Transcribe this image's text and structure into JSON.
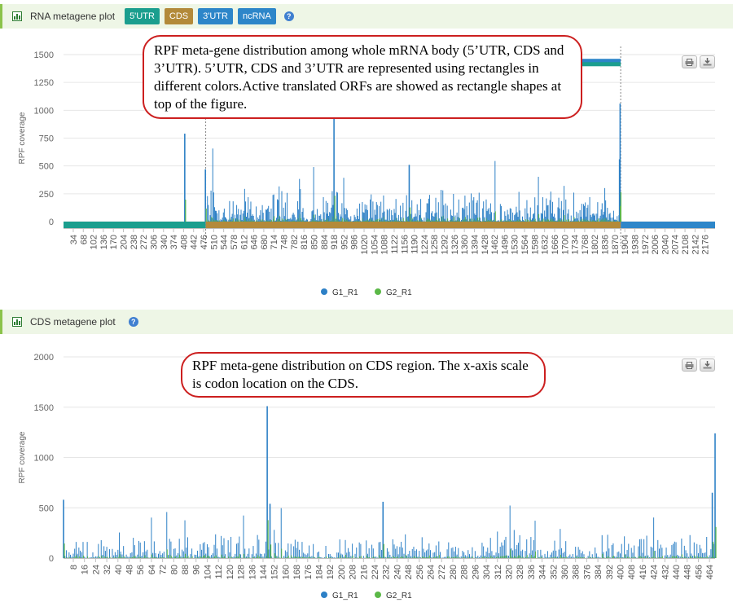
{
  "panels": [
    {
      "title": "RNA metagene plot",
      "badges": [
        {
          "label": "5'UTR",
          "color": "#1b9e8e"
        },
        {
          "label": "CDS",
          "color": "#b38a3a"
        },
        {
          "label": "3'UTR",
          "color": "#2d86c9"
        },
        {
          "label": "ncRNA",
          "color": "#2d86c9"
        }
      ]
    },
    {
      "title": "CDS metagene plot",
      "badges": []
    }
  ],
  "annotations": {
    "rna": "RPF meta-gene distribution among whole mRNA body (5’UTR, CDS and 3’UTR). 5’UTR, CDS and 3’UTR are represented using rectangles in different colors.Active translated ORFs are showed as rectangle shapes at top of the figure.",
    "cds": "RPF meta-gene distribution on CDS region. The x-axis scale is codon location on the CDS."
  },
  "colors": {
    "G1_R1": "#2d80c6",
    "G2_R1": "#5bb847",
    "utr5": "#1b9e8e",
    "cds": "#b38a3a",
    "utr3": "#2d86c9",
    "orf": "#1b9e8e"
  },
  "chart_data": [
    {
      "type": "bar",
      "title": "RNA metagene plot",
      "ylabel": "RPF coverage",
      "xlabel": "",
      "ylim": [
        0,
        1500
      ],
      "yticks": [
        0,
        250,
        500,
        750,
        1000,
        1250,
        1500
      ],
      "xlim": [
        1,
        2210
      ],
      "xticks": [
        34,
        68,
        102,
        136,
        170,
        204,
        238,
        272,
        306,
        340,
        374,
        408,
        442,
        476,
        510,
        544,
        578,
        612,
        646,
        680,
        714,
        748,
        782,
        816,
        850,
        884,
        918,
        952,
        986,
        1020,
        1054,
        1088,
        1122,
        1156,
        1190,
        1224,
        1258,
        1292,
        1326,
        1360,
        1394,
        1428,
        1462,
        1496,
        1530,
        1564,
        1598,
        1632,
        1666,
        1700,
        1734,
        1768,
        1802,
        1836,
        1870,
        1904,
        1938,
        1972,
        2006,
        2040,
        2074,
        2108,
        2142,
        2176
      ],
      "regions": [
        {
          "name": "5'UTR",
          "start": 1,
          "end": 483
        },
        {
          "name": "CDS",
          "start": 483,
          "end": 1890
        },
        {
          "name": "3'UTR",
          "start": 1890,
          "end": 2210
        }
      ],
      "orfs": [
        {
          "start": 1640,
          "end": 1890,
          "y": 1440
        },
        {
          "start": 1640,
          "end": 1890,
          "y": 1410
        }
      ],
      "spikes": [
        {
          "x": 412,
          "y": 790
        },
        {
          "x": 482,
          "y": 470
        },
        {
          "x": 918,
          "y": 930
        },
        {
          "x": 1173,
          "y": 510
        },
        {
          "x": 1888,
          "y": 1060
        },
        {
          "x": 1886,
          "y": 560
        }
      ],
      "noise_range": [
        483,
        1890
      ],
      "noise_max": 320,
      "series": [
        {
          "name": "G1_R1"
        },
        {
          "name": "G2_R1"
        }
      ],
      "legend": "bottom"
    },
    {
      "type": "bar",
      "title": "CDS metagene plot",
      "ylabel": "RPF coverage",
      "xlabel": "",
      "ylim": [
        0,
        2000
      ],
      "yticks": [
        0,
        500,
        1000,
        1500,
        2000
      ],
      "xlim": [
        1,
        468
      ],
      "xticks": [
        8,
        16,
        24,
        32,
        40,
        48,
        56,
        64,
        72,
        80,
        88,
        96,
        104,
        112,
        120,
        128,
        136,
        144,
        152,
        160,
        168,
        176,
        184,
        192,
        200,
        208,
        216,
        224,
        232,
        240,
        248,
        256,
        264,
        272,
        280,
        288,
        296,
        304,
        312,
        320,
        328,
        336,
        344,
        352,
        360,
        368,
        376,
        384,
        392,
        400,
        408,
        416,
        424,
        432,
        440,
        448,
        456,
        464
      ],
      "spikes": [
        {
          "x": 1,
          "y": 580
        },
        {
          "x": 147,
          "y": 1510
        },
        {
          "x": 149,
          "y": 540
        },
        {
          "x": 230,
          "y": 560
        },
        {
          "x": 468,
          "y": 1240
        },
        {
          "x": 466,
          "y": 650
        }
      ],
      "noise_max": 420,
      "series": [
        {
          "name": "G1_R1"
        },
        {
          "name": "G2_R1"
        }
      ],
      "legend": "bottom"
    }
  ]
}
